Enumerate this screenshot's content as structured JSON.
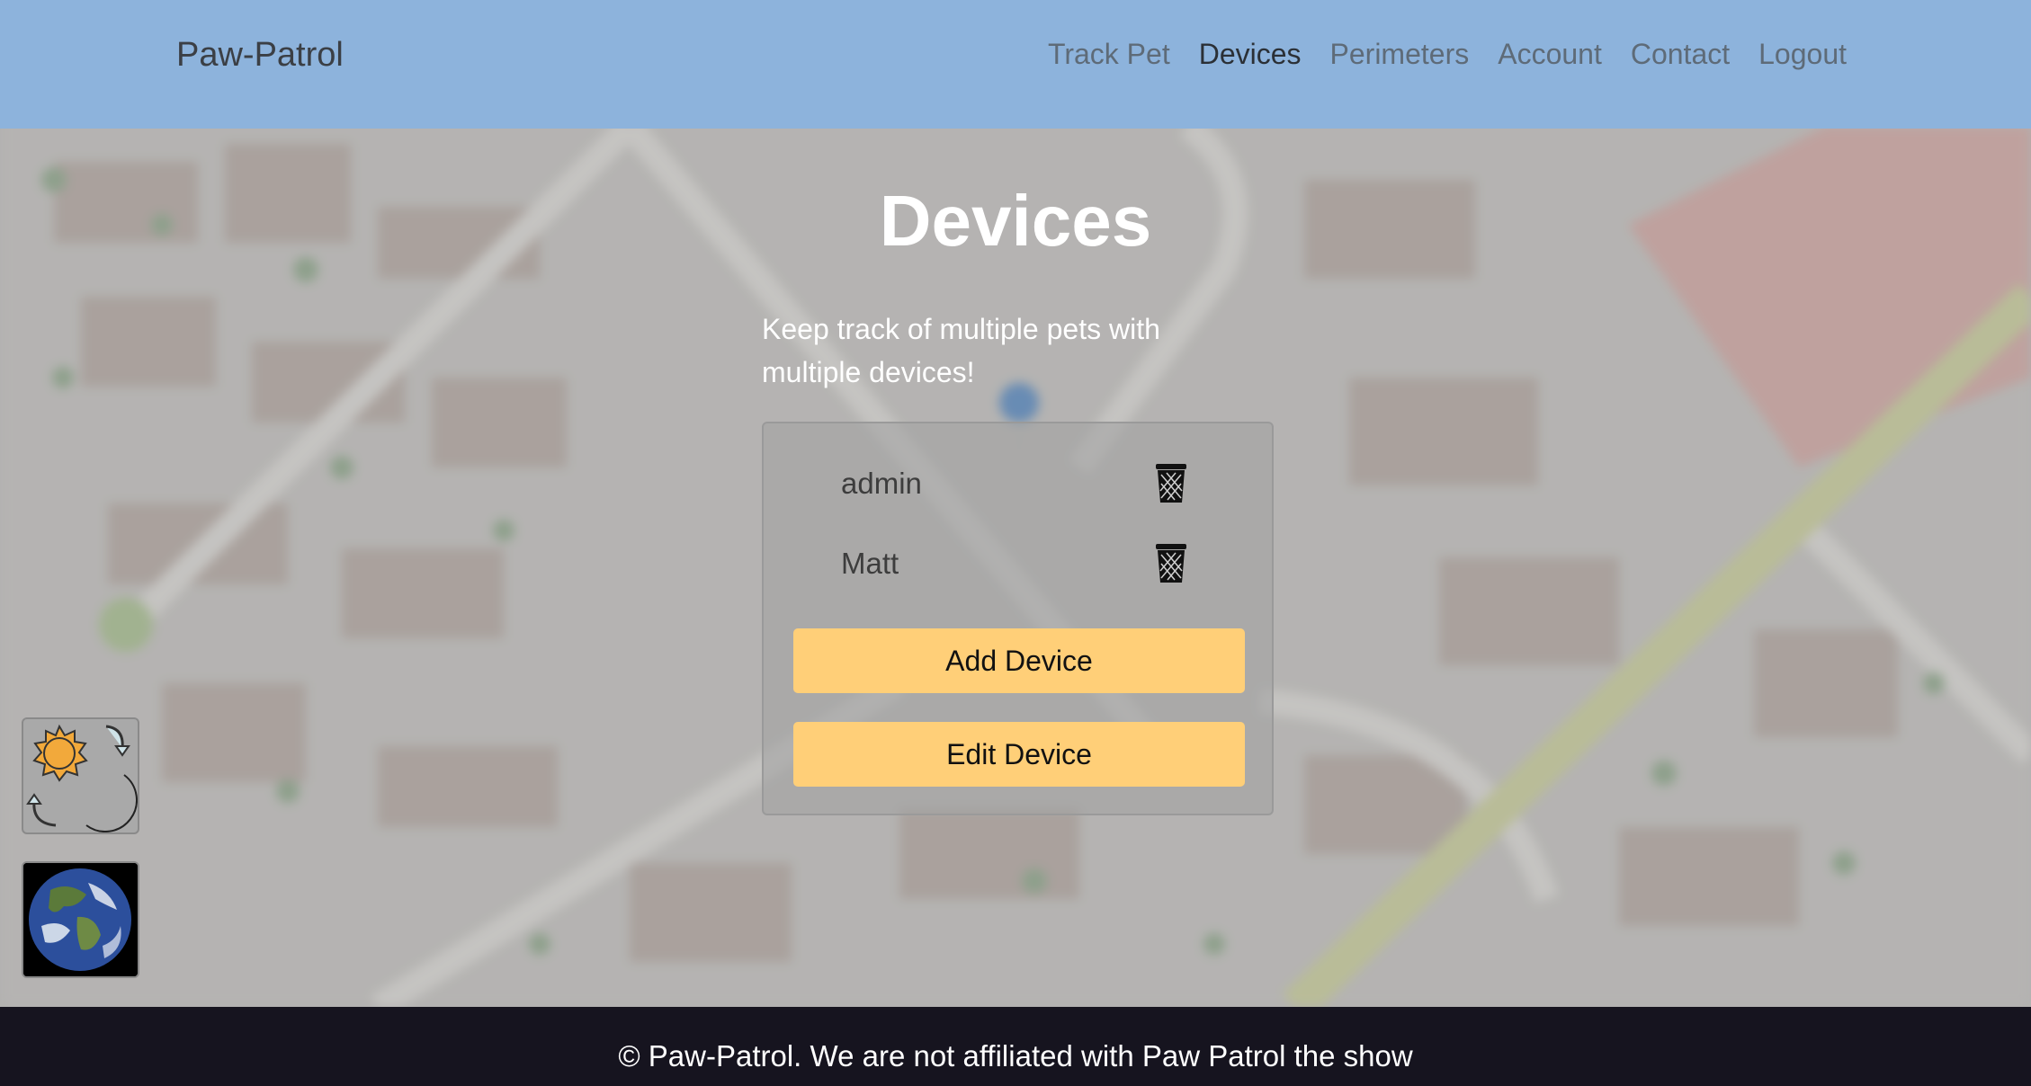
{
  "navbar": {
    "brand": "Paw-Patrol",
    "links": [
      {
        "label": "Track Pet",
        "active": false
      },
      {
        "label": "Devices",
        "active": true
      },
      {
        "label": "Perimeters",
        "active": false
      },
      {
        "label": "Account",
        "active": false
      },
      {
        "label": "Contact",
        "active": false
      },
      {
        "label": "Logout",
        "active": false
      }
    ]
  },
  "main": {
    "title": "Devices",
    "subtitle": "Keep track of multiple pets with multiple devices!",
    "devices": [
      {
        "name": "admin",
        "action_icon": "trash-icon"
      },
      {
        "name": "Matt",
        "action_icon": "trash-icon"
      }
    ],
    "add_button": "Add Device",
    "edit_button": "Edit Device"
  },
  "widgets": {
    "theme_toggle_icon": "sun-moon-toggle-icon",
    "map_style_icon": "earth-globe-icon"
  },
  "footer": {
    "text": "© Paw-Patrol. We are not affiliated with Paw Patrol the show"
  },
  "colors": {
    "navbar": "#8db3dc",
    "button": "#ffcf78",
    "footer": "#16141f"
  }
}
